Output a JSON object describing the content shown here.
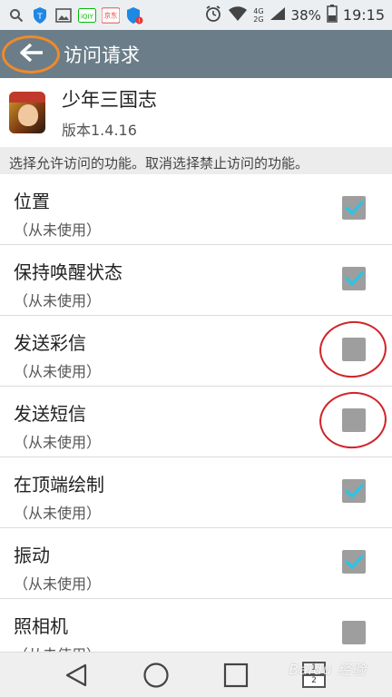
{
  "status_bar": {
    "left_icons": [
      "search-icon",
      "shield-icon",
      "image-icon",
      "iqiyi-icon",
      "jd-icon",
      "shield-alert-icon"
    ],
    "jd_label": "京东",
    "iqiyi_label": "iQIY",
    "net_top": "4G",
    "net_bottom": "2G",
    "battery": "38%",
    "time": "19:15"
  },
  "header": {
    "title": "访问请求",
    "bar_color": "#6b7d88",
    "highlight_color": "#f08a2a"
  },
  "app": {
    "name": "少年三国志",
    "version": "版本1.4.16"
  },
  "description": "选择允许访问的功能。取消选择禁止访问的功能。",
  "permissions": [
    {
      "title": "位置",
      "subtitle": "（从未使用）",
      "checked": true
    },
    {
      "title": "保持唤醒状态",
      "subtitle": "（从未使用）",
      "checked": true
    },
    {
      "title": "发送彩信",
      "subtitle": "（从未使用）",
      "checked": false,
      "circled": true
    },
    {
      "title": "发送短信",
      "subtitle": "（从未使用）",
      "checked": false,
      "circled": true
    },
    {
      "title": "在顶端绘制",
      "subtitle": "（从未使用）",
      "checked": true
    },
    {
      "title": "振动",
      "subtitle": "（从未使用）",
      "checked": true
    },
    {
      "title": "照相机",
      "subtitle": "（从未使用）",
      "checked": false
    }
  ],
  "colors": {
    "check_mark": "#29c5e6",
    "checkbox": "#9e9e9e",
    "annotation": "#d0242b"
  },
  "nav": {
    "dual_top": "1",
    "dual_bottom": "2"
  },
  "watermark": "Baidu 经验"
}
